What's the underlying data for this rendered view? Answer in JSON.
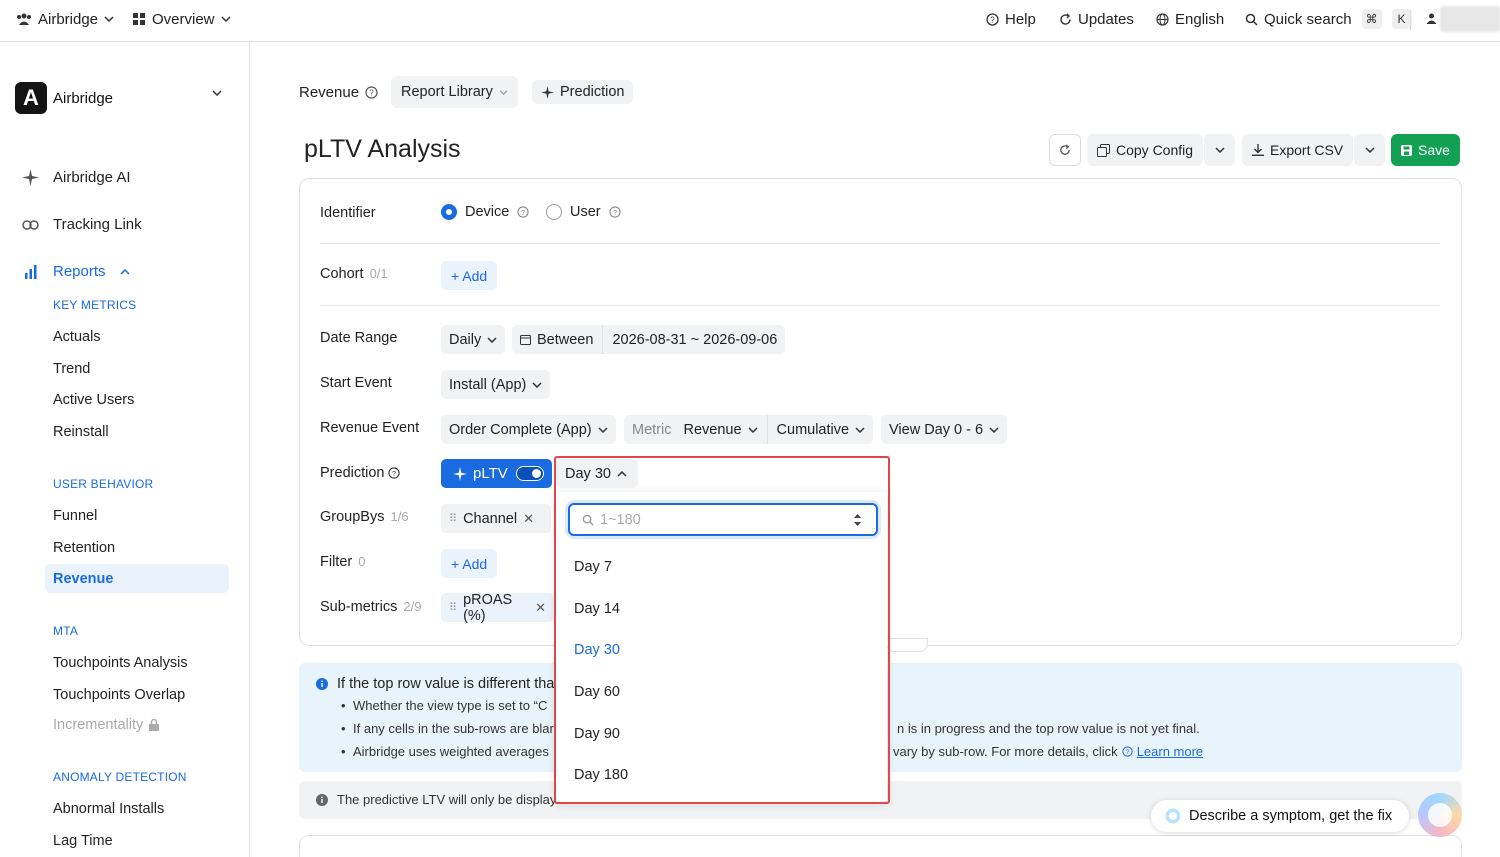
{
  "topbar": {
    "org": "Airbridge",
    "view": "Overview",
    "help": "Help",
    "updates": "Updates",
    "language": "English",
    "quick_search": "Quick search",
    "kbd_cmd": "⌘",
    "kbd_k": "K"
  },
  "sidebar": {
    "workspace": "Airbridge",
    "logo_letter": "A",
    "ai": "Airbridge AI",
    "tracking": "Tracking Link",
    "reports": "Reports",
    "sections": {
      "key_metrics": "KEY METRICS",
      "user_behavior": "USER BEHAVIOR",
      "mta": "MTA",
      "anomaly": "ANOMALY DETECTION"
    },
    "items": {
      "actuals": "Actuals",
      "trend": "Trend",
      "active_users": "Active Users",
      "reinstall": "Reinstall",
      "funnel": "Funnel",
      "retention": "Retention",
      "revenue": "Revenue",
      "touch_analysis": "Touchpoints Analysis",
      "touch_overlap": "Touchpoints Overlap",
      "incrementality": "Incrementality",
      "abnormal": "Abnormal Installs",
      "lag": "Lag Time"
    }
  },
  "header": {
    "crumb": "Revenue",
    "report_library": "Report Library",
    "prediction": "Prediction",
    "title": "pLTV Analysis",
    "copy_config": "Copy Config",
    "export_csv": "Export CSV",
    "save": "Save"
  },
  "form": {
    "identifier": {
      "label": "Identifier",
      "device": "Device",
      "user": "User",
      "selected": "Device"
    },
    "cohort": {
      "label": "Cohort",
      "count": "0/1",
      "add": "+ Add"
    },
    "date_range": {
      "label": "Date Range",
      "granularity": "Daily",
      "mode": "Between",
      "range": "2026-08-31 ~ 2026-09-06"
    },
    "start_event": {
      "label": "Start Event",
      "value": "Install (App)"
    },
    "revenue_event": {
      "label": "Revenue Event",
      "event": "Order Complete (App)",
      "metric_label": "Metric",
      "metric": "Revenue",
      "type": "Cumulative",
      "view": "View Day 0 - 6"
    },
    "prediction": {
      "label": "Prediction",
      "toggle": "pLTV",
      "day": "Day 30"
    },
    "groupbys": {
      "label": "GroupBys",
      "count": "1/6",
      "chip": "Channel"
    },
    "filter": {
      "label": "Filter",
      "count": "0",
      "add": "+ Add"
    },
    "submetrics": {
      "label": "Sub-metrics",
      "count": "2/9",
      "chip": "pROAS (%)"
    }
  },
  "dropdown": {
    "placeholder": "1~180",
    "options": [
      "Day 7",
      "Day 14",
      "Day 30",
      "Day 60",
      "Day 90",
      "Day 180"
    ],
    "selected": "Day 30"
  },
  "info": {
    "title": "If the top row value is different tha",
    "b1": "Whether the view type is set to “C",
    "b2": "If any cells in the sub-rows are blar",
    "b2_tail": "n is in progress and the top row value is not yet final.",
    "b3": "Airbridge uses weighted averages",
    "b3_tail": "vary by sub-row. For more details, click",
    "learn_more": "Learn more"
  },
  "note": "The predictive LTV will only be display",
  "assistant": "Describe a symptom, get the fix",
  "colors": {
    "accent": "#1a6be0",
    "save": "#12a054",
    "highlight": "#e0474c",
    "info_bg": "#e8f4fc"
  }
}
